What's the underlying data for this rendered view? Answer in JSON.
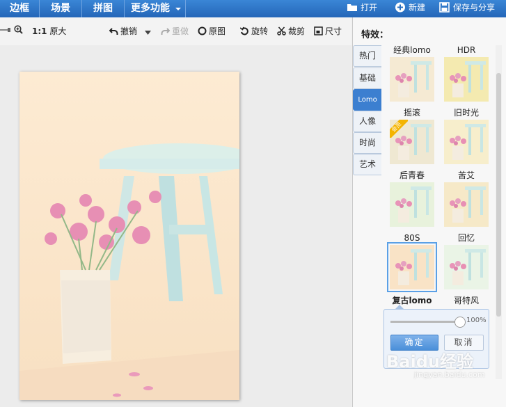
{
  "top_tabs": [
    "边框",
    "场景",
    "拼图",
    "更多功能"
  ],
  "top_actions": {
    "open": "打开",
    "new": "新建",
    "save_share": "保存与分享"
  },
  "toolbar": {
    "zoom_ratio": "1:1",
    "original_size": "原大",
    "undo": "撤销",
    "redo": "重做",
    "original_image": "原图",
    "rotate": "旋转",
    "crop": "裁剪",
    "size": "尺寸"
  },
  "panel": {
    "title": "特效：",
    "side_tabs": [
      "热门",
      "基础",
      "Lomo",
      "人像",
      "时尚",
      "艺术"
    ],
    "active_tab": "Lomo",
    "effects": [
      {
        "name": "经典lomo",
        "tint": "#f5ead3"
      },
      {
        "name": "HDR",
        "tint": "#f4eab0"
      },
      {
        "name": "摇滚",
        "tint": "#efe8d2",
        "badge": "会员"
      },
      {
        "name": "旧时光",
        "tint": "#f7eecc"
      },
      {
        "name": "后青春",
        "tint": "#e8f2dc"
      },
      {
        "name": "苦艾",
        "tint": "#f6e9c8"
      },
      {
        "name": "80S",
        "tint": "#f9e3c6"
      },
      {
        "name": "回忆",
        "tint": "#eaf4e6"
      },
      {
        "name": "复古lomo",
        "tint": "#f9e7c8"
      },
      {
        "name": "哥特风",
        "tint": "#eef0ee"
      }
    ],
    "selected_effect": "复古lomo",
    "adjust": {
      "percent": "100%",
      "ok": "确定",
      "cancel": "取消",
      "level": 1.0
    }
  },
  "watermark": {
    "brand": "Baidu经验",
    "url": "jingyan.baidu.com"
  },
  "colors": {
    "accent": "#3c7fd0",
    "topbar": "#2a6fc0",
    "photo_tint": "#fbe8cc"
  }
}
